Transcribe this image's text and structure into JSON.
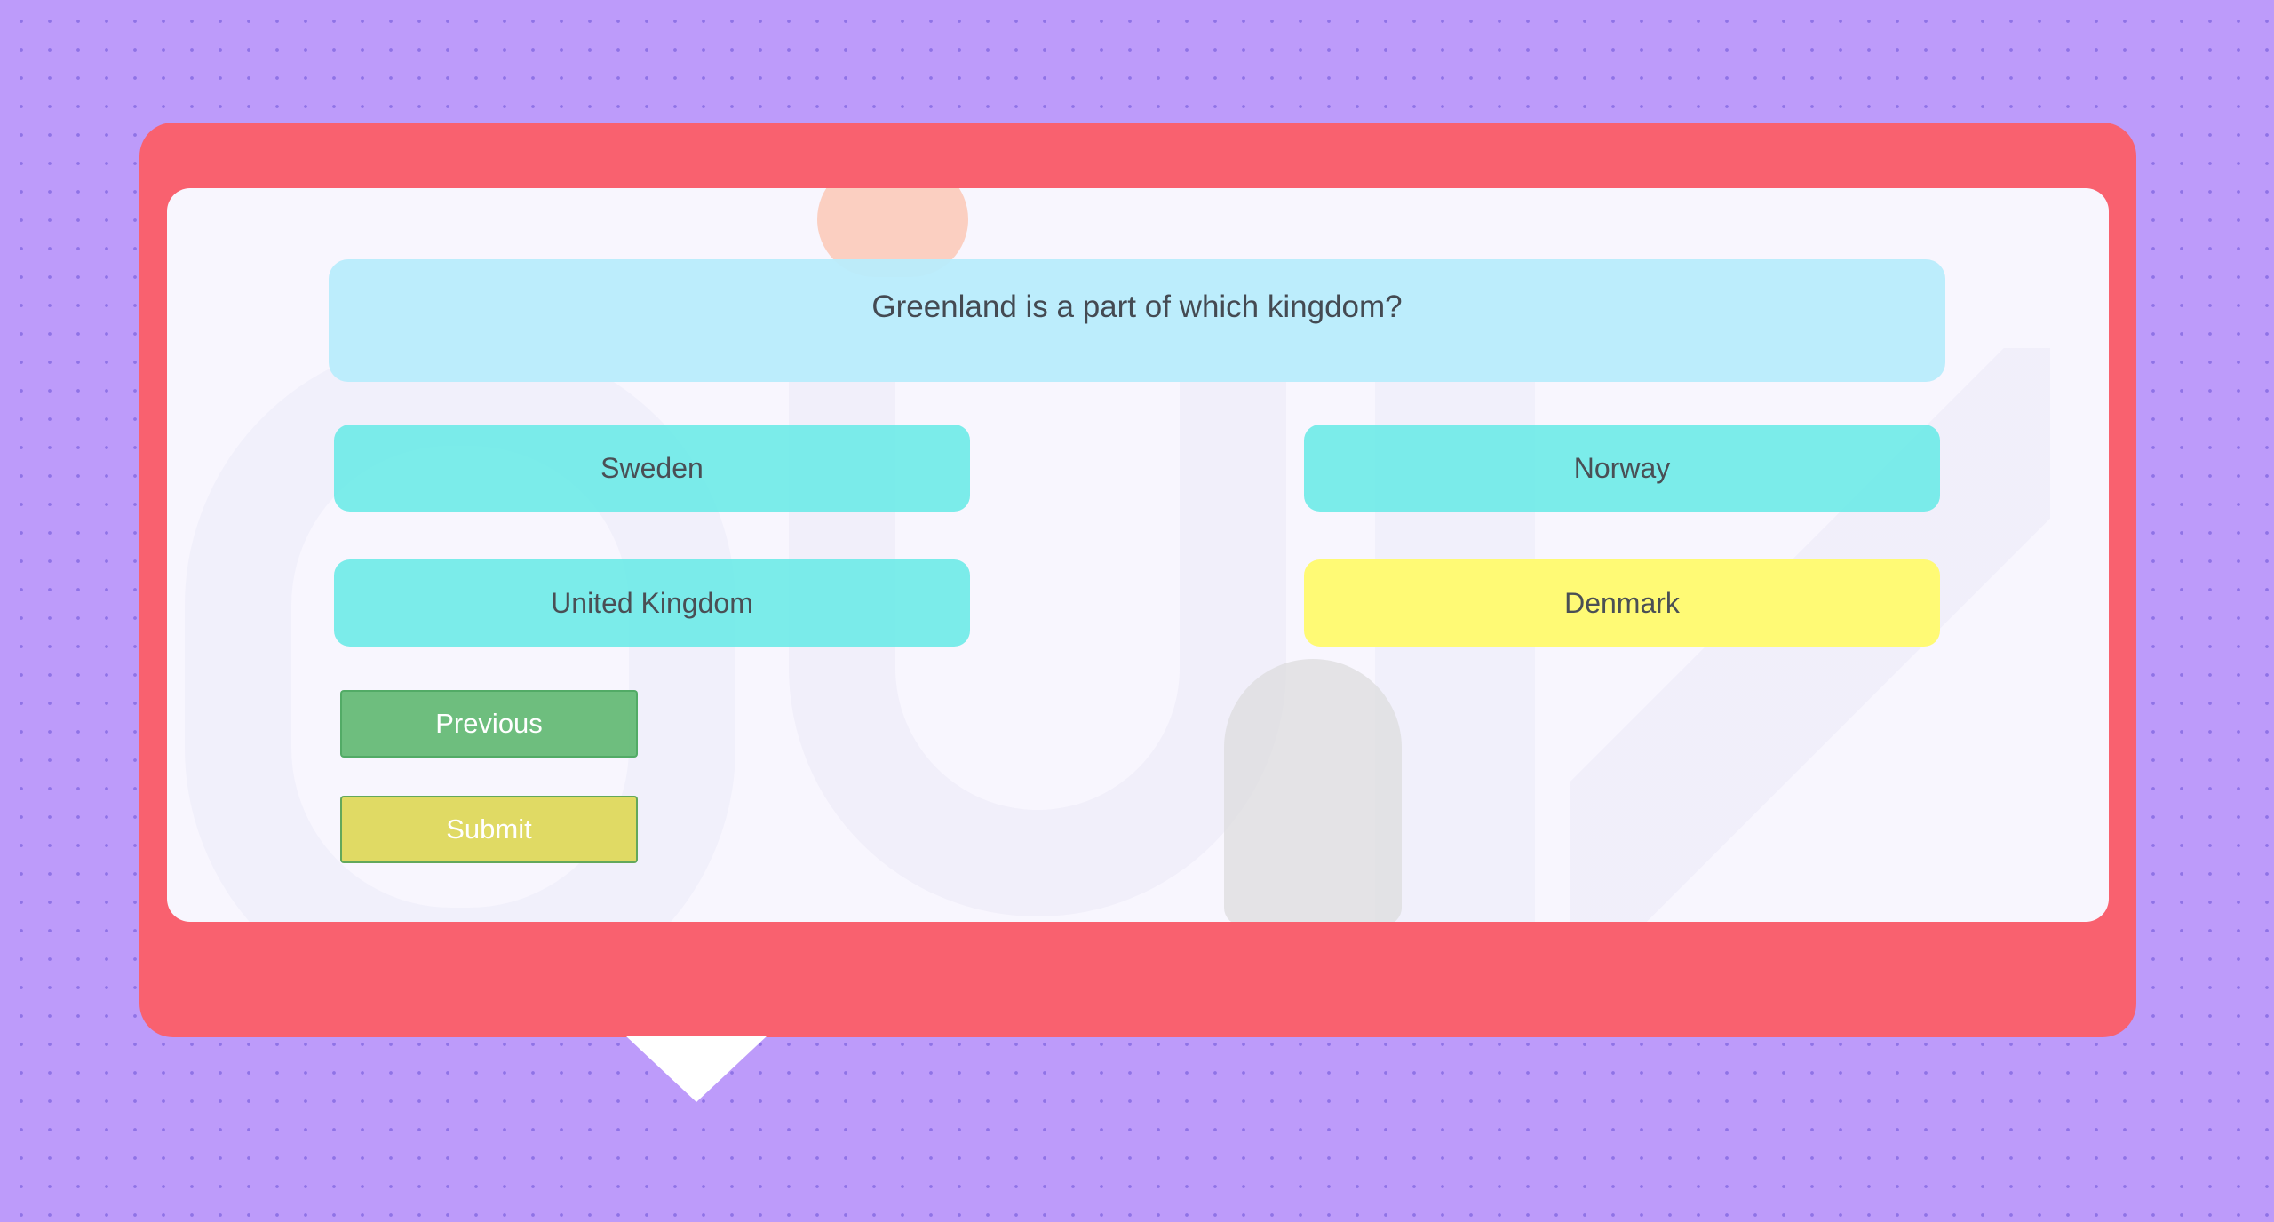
{
  "quiz": {
    "question": "Greenland is a part of which kingdom?",
    "answers": [
      {
        "label": "Sweden",
        "state": "default"
      },
      {
        "label": "Norway",
        "state": "default"
      },
      {
        "label": "United Kingdom",
        "state": "default"
      },
      {
        "label": "Denmark",
        "state": "selected"
      }
    ],
    "previous_label": "Previous",
    "submit_label": "Submit"
  },
  "colors": {
    "background": "#bd9bfa",
    "frame": "#f9616f",
    "panel": "#f8f6fe",
    "question_bg": "#b8ecfc",
    "answer_default": "#70eae8",
    "answer_selected": "#fffa6e",
    "previous_button": "#5eb870",
    "submit_button": "#ded85c"
  }
}
